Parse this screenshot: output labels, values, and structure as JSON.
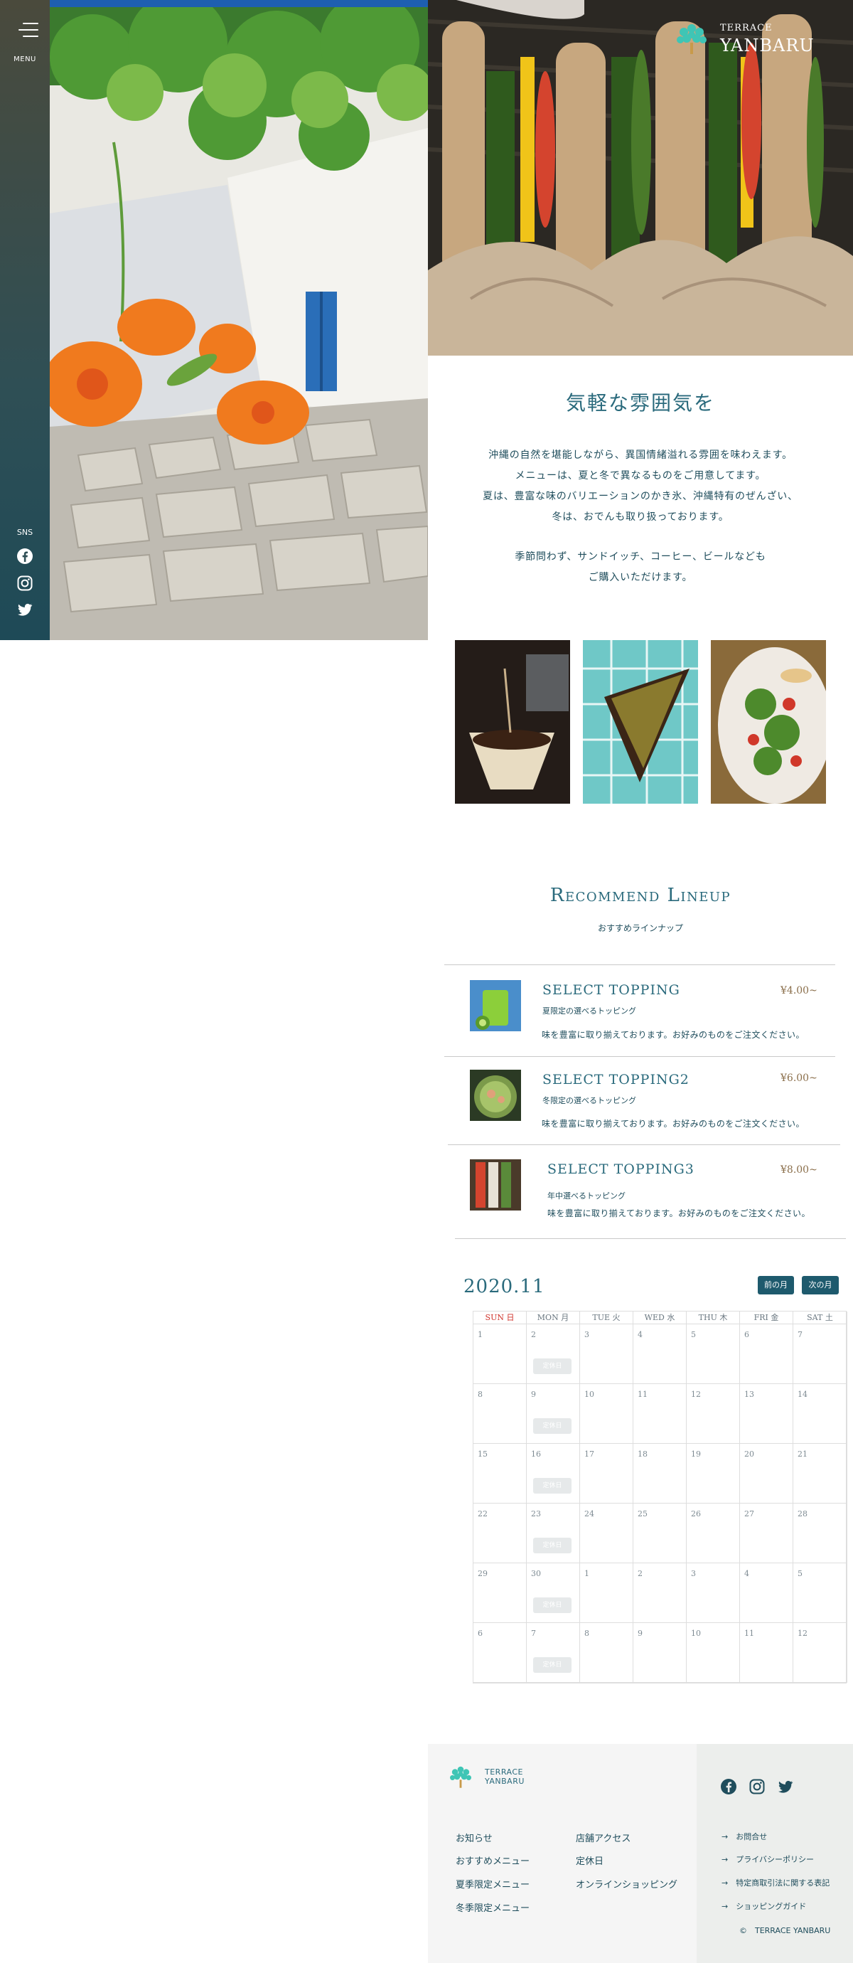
{
  "sidebar": {
    "menu_label": "MENU",
    "sns_label": "SNS",
    "icons": [
      "facebook-icon",
      "instagram-icon",
      "twitter-icon"
    ]
  },
  "brand": {
    "line1": "TERRACE",
    "line2": "YANBARU"
  },
  "intro": {
    "title": "気軽な雰囲気を",
    "paragraph1": [
      "沖縄の自然を堪能しながら、異国情緒溢れる雰囲を味わえます。",
      "メニューは、夏と冬で異なるものをご用意してます。",
      "夏は、豊富な味のバリエーションのかき氷、沖縄特有のぜんざい、",
      "冬は、おでんも取り扱っております。"
    ],
    "paragraph2": [
      "季節問わず、サンドイッチ、コーヒー、ビールなども",
      "ご購入いただけます。"
    ]
  },
  "recommend": {
    "title": "Recommend Lineup",
    "subtitle": "おすすめラインナップ",
    "items": [
      {
        "name": "SELECT TOPPING",
        "price": "¥4.00~",
        "sub": "夏限定の選べるトッピング",
        "desc": "味を豊富に取り揃えております。お好みのものをご注文ください。"
      },
      {
        "name": "SELECT TOPPING2",
        "price": "¥6.00~",
        "sub": "冬限定の選べるトッピング",
        "desc": "味を豊富に取り揃えております。お好みのものをご注文ください。"
      },
      {
        "name": "SELECT TOPPING3",
        "price": "¥8.00~",
        "sub": "年中選べるトッピング",
        "desc": "味を豊富に取り揃えております。お好みのものをご注文ください。"
      }
    ]
  },
  "calendar": {
    "title": "2020.11",
    "prev_label": "前の月",
    "next_label": "次の月",
    "weekdays": [
      "SUN 日",
      "MON 月",
      "TUE 火",
      "WED 水",
      "THU 木",
      "FRI 金",
      "SAT 土"
    ],
    "weeks": [
      [
        "1",
        "2",
        "3",
        "4",
        "5",
        "6",
        "7"
      ],
      [
        "8",
        "9",
        "10",
        "11",
        "12",
        "13",
        "14"
      ],
      [
        "15",
        "16",
        "17",
        "18",
        "19",
        "20",
        "21"
      ],
      [
        "22",
        "23",
        "24",
        "25",
        "26",
        "27",
        "28"
      ],
      [
        "29",
        "30",
        "1",
        "2",
        "3",
        "4",
        "5"
      ],
      [
        "6",
        "7",
        "8",
        "9",
        "10",
        "11",
        "12"
      ]
    ],
    "holiday_label": "定休日"
  },
  "footer": {
    "brand_line1": "TERRACE",
    "brand_line2": "YANBARU",
    "col1": [
      "お知らせ",
      "おすすめメニュー",
      "夏季限定メニュー",
      "冬季限定メニュー"
    ],
    "col2": [
      "店舗アクセス",
      "定休日",
      "オンラインショッピング"
    ],
    "right_links": [
      "お問合せ",
      "プライバシーポリシー",
      "特定商取引法に関する表記",
      "ショッピングガイド"
    ],
    "arrow": "→",
    "copyright": "©　TERRACE YANBARU"
  },
  "colors": {
    "sidebar_top": "#4a4a3c",
    "sidebar_bottom": "#1e4a57",
    "accent": "#2a6a7c",
    "button": "#1e5a6d",
    "price": "#8a6e4a",
    "sunday": "#d0332b"
  }
}
